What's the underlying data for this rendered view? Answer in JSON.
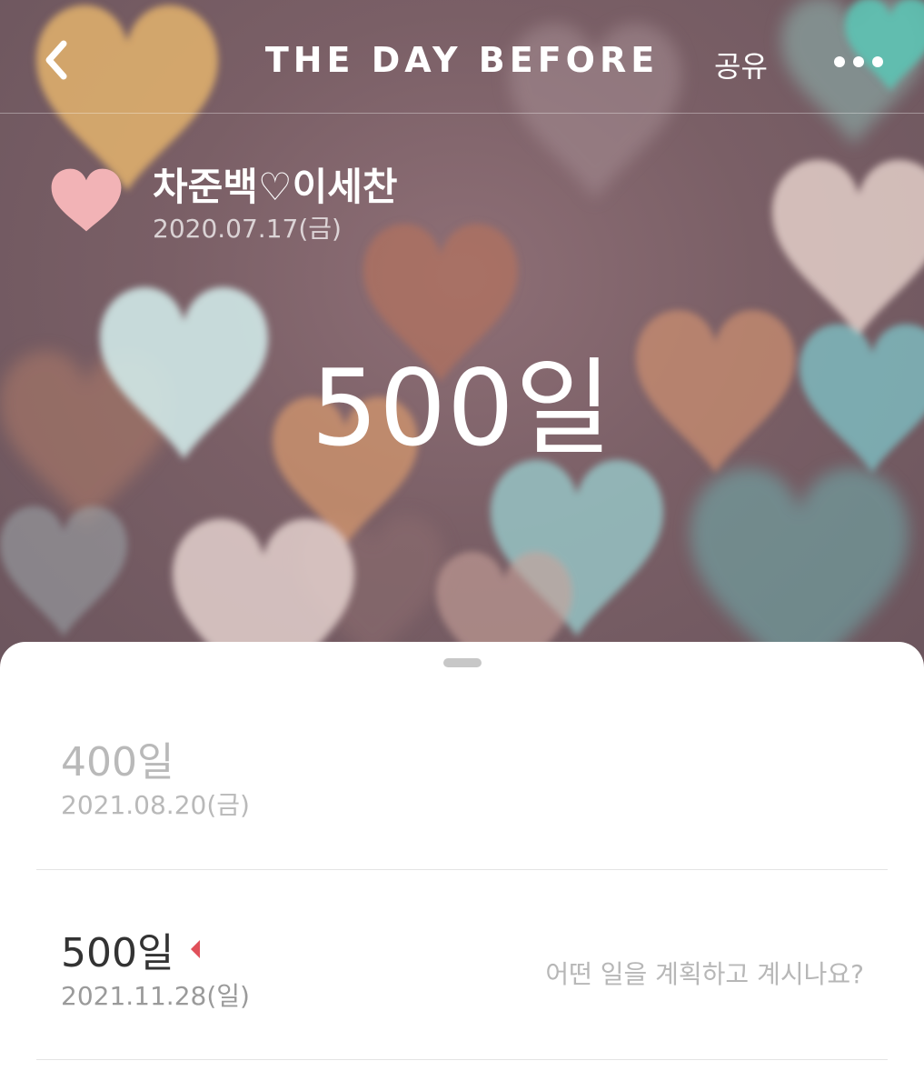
{
  "nav": {
    "back_icon": "chevron-left-icon",
    "logo_text": "THE DAY BEFORE",
    "share_label": "공유",
    "more_icon": "more-horizontal-icon"
  },
  "event": {
    "title": "차준백♡이세찬",
    "date": "2020.07.17(금)",
    "count": "500일",
    "heart_icon": "heart-icon",
    "heart_color": "#f2b3b6"
  },
  "milestones": [
    {
      "label": "400일",
      "date": "2021.08.20(금)",
      "state": "past"
    },
    {
      "label": "500일",
      "date": "2021.11.28(일)",
      "state": "current",
      "marker_color": "#e0505a",
      "plan_placeholder": "어떤 일을 계획하고 계시나요?"
    }
  ],
  "colors": {
    "hero_background": "#7a5f66",
    "sheet_background": "#ffffff",
    "muted_text": "#b9b9b9",
    "accent": "#e0505a"
  }
}
